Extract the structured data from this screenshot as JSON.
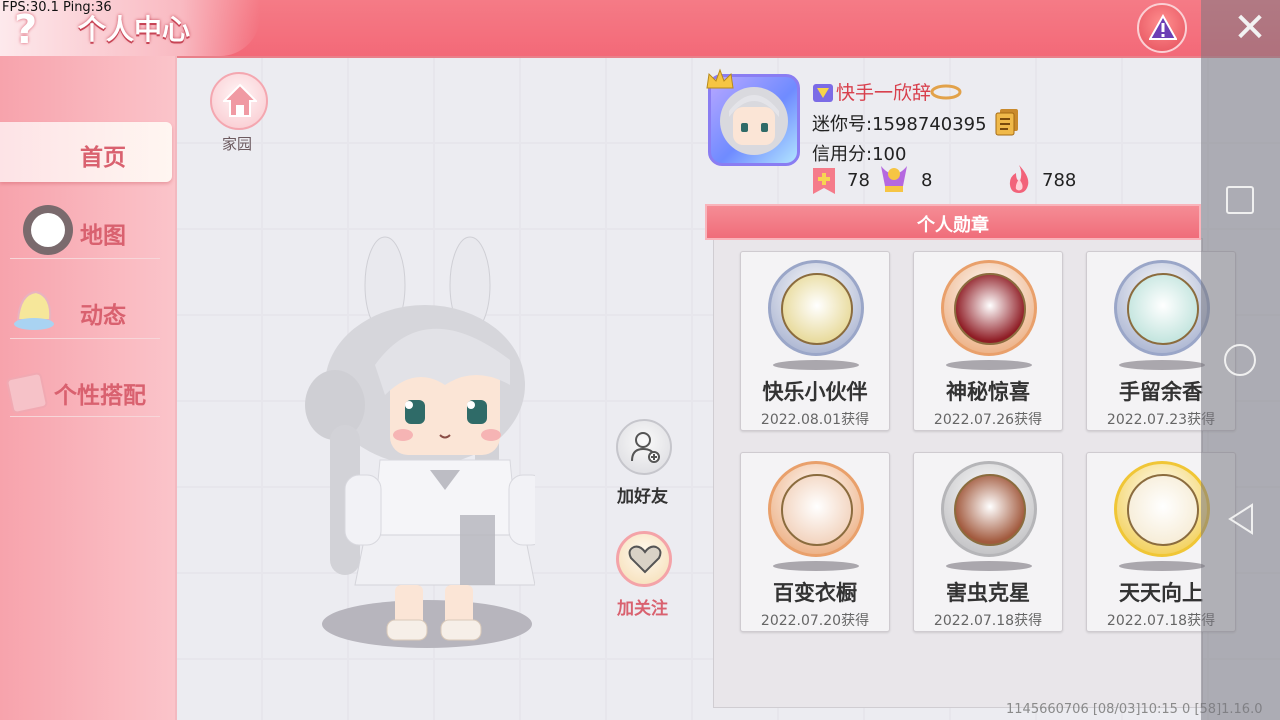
{
  "debug": {
    "fps_text": "FPS:30.1  Ping:36"
  },
  "header": {
    "title": "个人中心",
    "help_icon": "?",
    "close_icon": "✕",
    "warn_icon": "warning-icon"
  },
  "sidebar": {
    "items": [
      {
        "label": "首页",
        "icon": "none",
        "active": true
      },
      {
        "label": "地图",
        "icon": "map-icon",
        "active": false
      },
      {
        "label": "动态",
        "icon": "bell-icon",
        "active": false
      },
      {
        "label": "个性搭配",
        "icon": "wardrobe-icon",
        "active": false
      }
    ]
  },
  "home": {
    "label": "家园"
  },
  "actions": {
    "add_friend_label": "加好友",
    "follow_label": "加关注"
  },
  "profile": {
    "nickname": "快手一欣辞",
    "mini_id": "迷你号:1598740395",
    "credit": "信用分:100",
    "stats": [
      {
        "icon": "plus-flag-icon",
        "value": "78"
      },
      {
        "icon": "trophy-icon",
        "value": "8"
      },
      {
        "icon": "flame-icon",
        "value": "788"
      }
    ]
  },
  "badges": {
    "header": "个人勋章",
    "items": [
      {
        "name": "快乐小伙伴",
        "date": "2022.08.01获得",
        "ring": "#9aa6c8",
        "fill": "#e9dca0"
      },
      {
        "name": "神秘惊喜",
        "date": "2022.07.26获得",
        "ring": "#e9a06b",
        "fill": "#8f1d25"
      },
      {
        "name": "手留余香",
        "date": "2022.07.23获得",
        "ring": "#9aa6c8",
        "fill": "#c6e6e0"
      },
      {
        "name": "百变衣橱",
        "date": "2022.07.20获得",
        "ring": "#e9a06b",
        "fill": "#f3d6c2"
      },
      {
        "name": "害虫克星",
        "date": "2022.07.18获得",
        "ring": "#b5b5b8",
        "fill": "#a25a3e"
      },
      {
        "name": "天天向上",
        "date": "2022.07.18获得",
        "ring": "#f0c636",
        "fill": "#f7eeda"
      }
    ]
  },
  "footer": {
    "info": "1145660706   [08/03]10:15 0   [58]1.16.0"
  },
  "colors": {
    "accent": "#f36978",
    "sidebar": "#f9b2ba",
    "text_red": "#d9616f"
  }
}
